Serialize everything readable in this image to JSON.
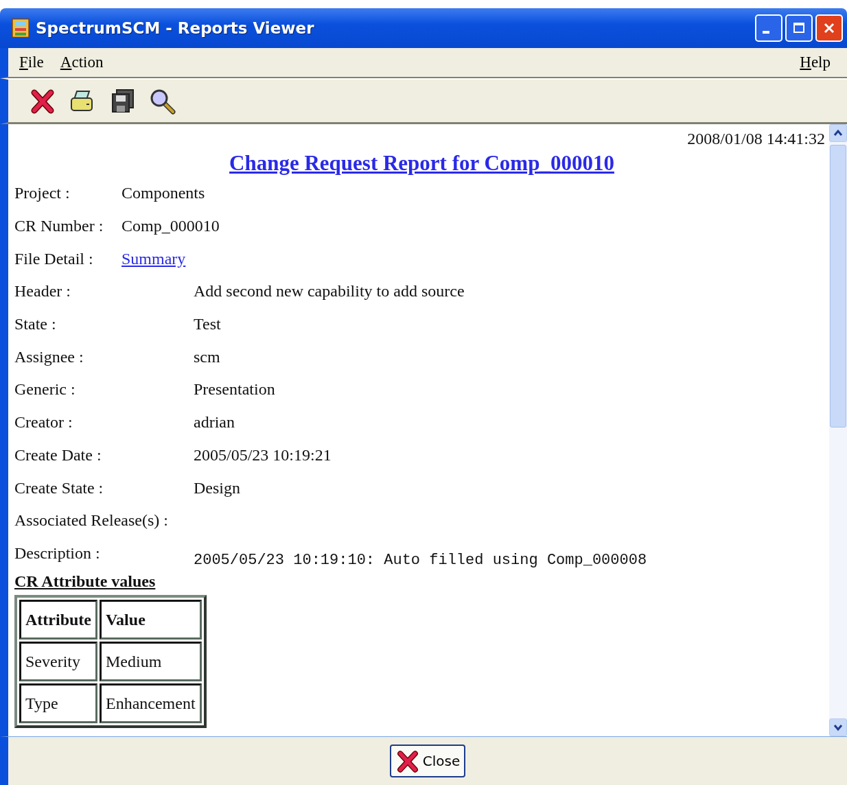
{
  "window": {
    "title": "SpectrumSCM - Reports Viewer"
  },
  "menu": {
    "left": [
      {
        "label": "File"
      },
      {
        "label": "Action"
      }
    ],
    "right": [
      {
        "label": "Help"
      }
    ]
  },
  "report": {
    "timestamp": "2008/01/08 14:41:32",
    "title": "Change Request Report for Comp_000010",
    "summary_fields": [
      {
        "label": "Project :",
        "value": "Components",
        "kind": "text"
      },
      {
        "label": "CR Number :",
        "value": "Comp_000010",
        "kind": "text"
      },
      {
        "label": "File Detail :",
        "value": "Summary",
        "kind": "link"
      }
    ],
    "detail_fields": [
      {
        "label": "Header :",
        "value": "Add second new capability to add source",
        "kind": "text"
      },
      {
        "label": "State :",
        "value": "Test",
        "kind": "text"
      },
      {
        "label": "Assignee :",
        "value": "scm",
        "kind": "text"
      },
      {
        "label": "Generic :",
        "value": "Presentation",
        "kind": "text"
      },
      {
        "label": "Creator :",
        "value": "adrian",
        "kind": "text"
      },
      {
        "label": "Create Date :",
        "value": "2005/05/23 10:19:21",
        "kind": "text"
      },
      {
        "label": "Create State :",
        "value": "Design",
        "kind": "text"
      },
      {
        "label": "Associated Release(s) :",
        "kind": "empty"
      },
      {
        "label": "Description :",
        "value": "2005/05/23 10:19:10: Auto filled using Comp_000008",
        "kind": "mono"
      }
    ],
    "attributes_heading": "CR Attribute values",
    "attributes_table": {
      "columns": [
        "Attribute",
        "Value"
      ],
      "rows": [
        [
          "Severity",
          "Medium"
        ],
        [
          "Type",
          "Enhancement"
        ]
      ]
    }
  },
  "close_button": {
    "label": "Close"
  }
}
